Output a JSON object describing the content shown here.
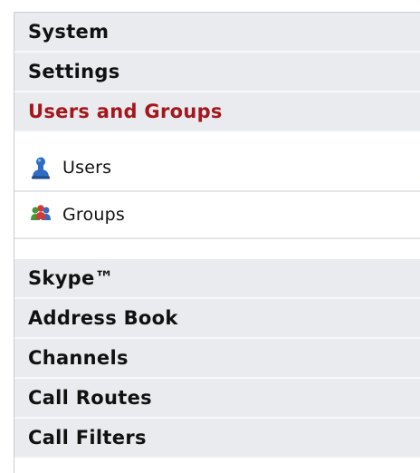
{
  "nav": {
    "top_sections": [
      {
        "label": "System"
      },
      {
        "label": "Settings"
      }
    ],
    "active_section": {
      "label": "Users and Groups",
      "items": [
        {
          "label": "Users",
          "icon": "user-icon"
        },
        {
          "label": "Groups",
          "icon": "group-icon"
        }
      ]
    },
    "bottom_sections": [
      {
        "label": "Skype™"
      },
      {
        "label": "Address Book"
      },
      {
        "label": "Channels"
      },
      {
        "label": "Call Routes"
      },
      {
        "label": "Call Filters"
      }
    ]
  },
  "colors": {
    "active_header_text": "#a3171d",
    "header_background": "#e9ebee",
    "user_icon": "#2f6cc4",
    "group_icon_red": "#d23a3a",
    "group_icon_green": "#3f9a3a",
    "group_icon_blue": "#2f6cc4"
  }
}
